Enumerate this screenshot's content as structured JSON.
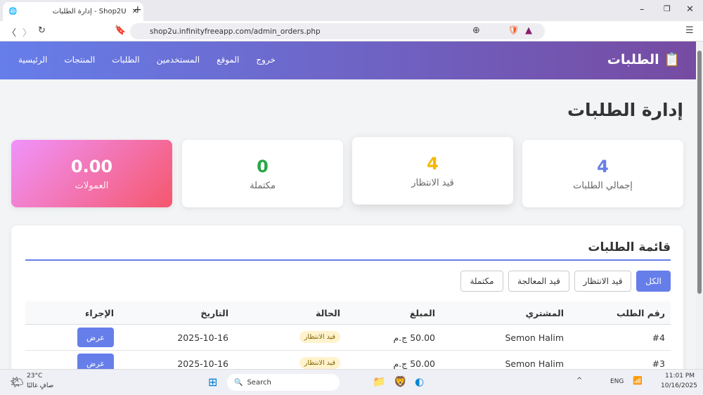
{
  "browser": {
    "tab_title": "إدارة الطلبات - Shop2U",
    "url": "shop2u.infinityfreeapp.com/admin_orders.php"
  },
  "header": {
    "brand": "الطلبات",
    "brand_icon": "clipboard-icon",
    "nav": [
      "الرئيسية",
      "المنتجات",
      "الطلبات",
      "المستخدمين",
      "الموقع",
      "خروج"
    ]
  },
  "page_title": "إدارة الطلبات",
  "stats": [
    {
      "value": "4",
      "label": "إجمالي الطلبات",
      "color": "#667eea"
    },
    {
      "value": "4",
      "label": "قيد الانتظار",
      "color": "#f6b800"
    },
    {
      "value": "0",
      "label": "مكتملة",
      "color": "#28a745"
    },
    {
      "value": "0.00",
      "label": "العمولات",
      "color": "#ffffff"
    }
  ],
  "orders": {
    "title": "قائمة الطلبات",
    "filters": [
      "الكل",
      "قيد الانتظار",
      "قيد المعالجة",
      "مكتملة"
    ],
    "columns": [
      "رقم الطلب",
      "المشتري",
      "المبلغ",
      "الحالة",
      "التاريخ",
      "الإجراء"
    ],
    "rows": [
      {
        "id": "#4",
        "buyer": "Semon Halim",
        "amount": "50.00 ج.م",
        "status": "قيد الانتظار",
        "date": "2025-10-16",
        "action": "عرض"
      },
      {
        "id": "#3",
        "buyer": "Semon Halim",
        "amount": "50.00 ج.م",
        "status": "قيد الانتظار",
        "date": "2025-10-16",
        "action": "عرض"
      }
    ]
  },
  "taskbar": {
    "temp": "23°C",
    "weather": "صافٍ غالبًا",
    "search": "Search",
    "lang": "ENG",
    "time": "11:01 PM",
    "date": "10/16/2025"
  }
}
